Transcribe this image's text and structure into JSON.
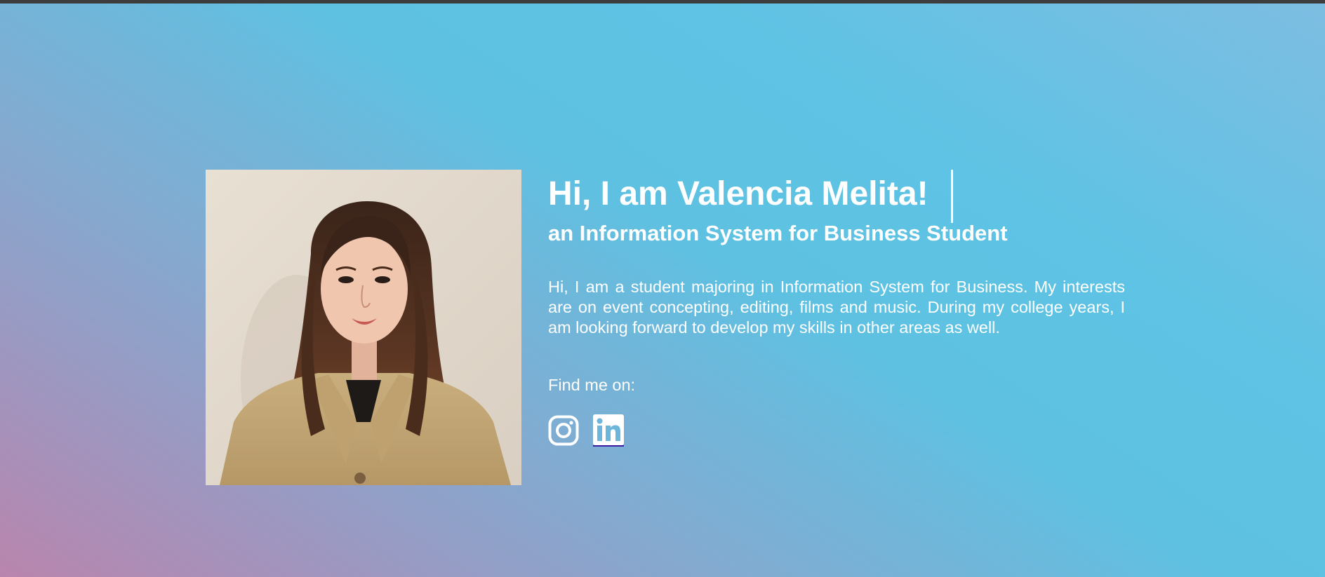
{
  "profile": {
    "headline": "Hi, I am Valencia Melita!",
    "subtitle": "an Information System for Business Student",
    "bio": "Hi, I am a student majoring in Information System for Business. My interests are on event concepting, editing, films and music. During my college years, I am looking forward to develop my skills in other areas as well.",
    "photo_alt": "Valencia Melita portrait"
  },
  "social": {
    "label": "Find me on:",
    "links": [
      {
        "name": "Instagram",
        "icon": "instagram-icon"
      },
      {
        "name": "LinkedIn",
        "icon": "linkedin-icon"
      }
    ]
  },
  "colors": {
    "text": "#ffffff",
    "gradient_pink": "#b985ad",
    "gradient_blue": "#5ec3e4",
    "top_bar": "#3d3d3d"
  }
}
